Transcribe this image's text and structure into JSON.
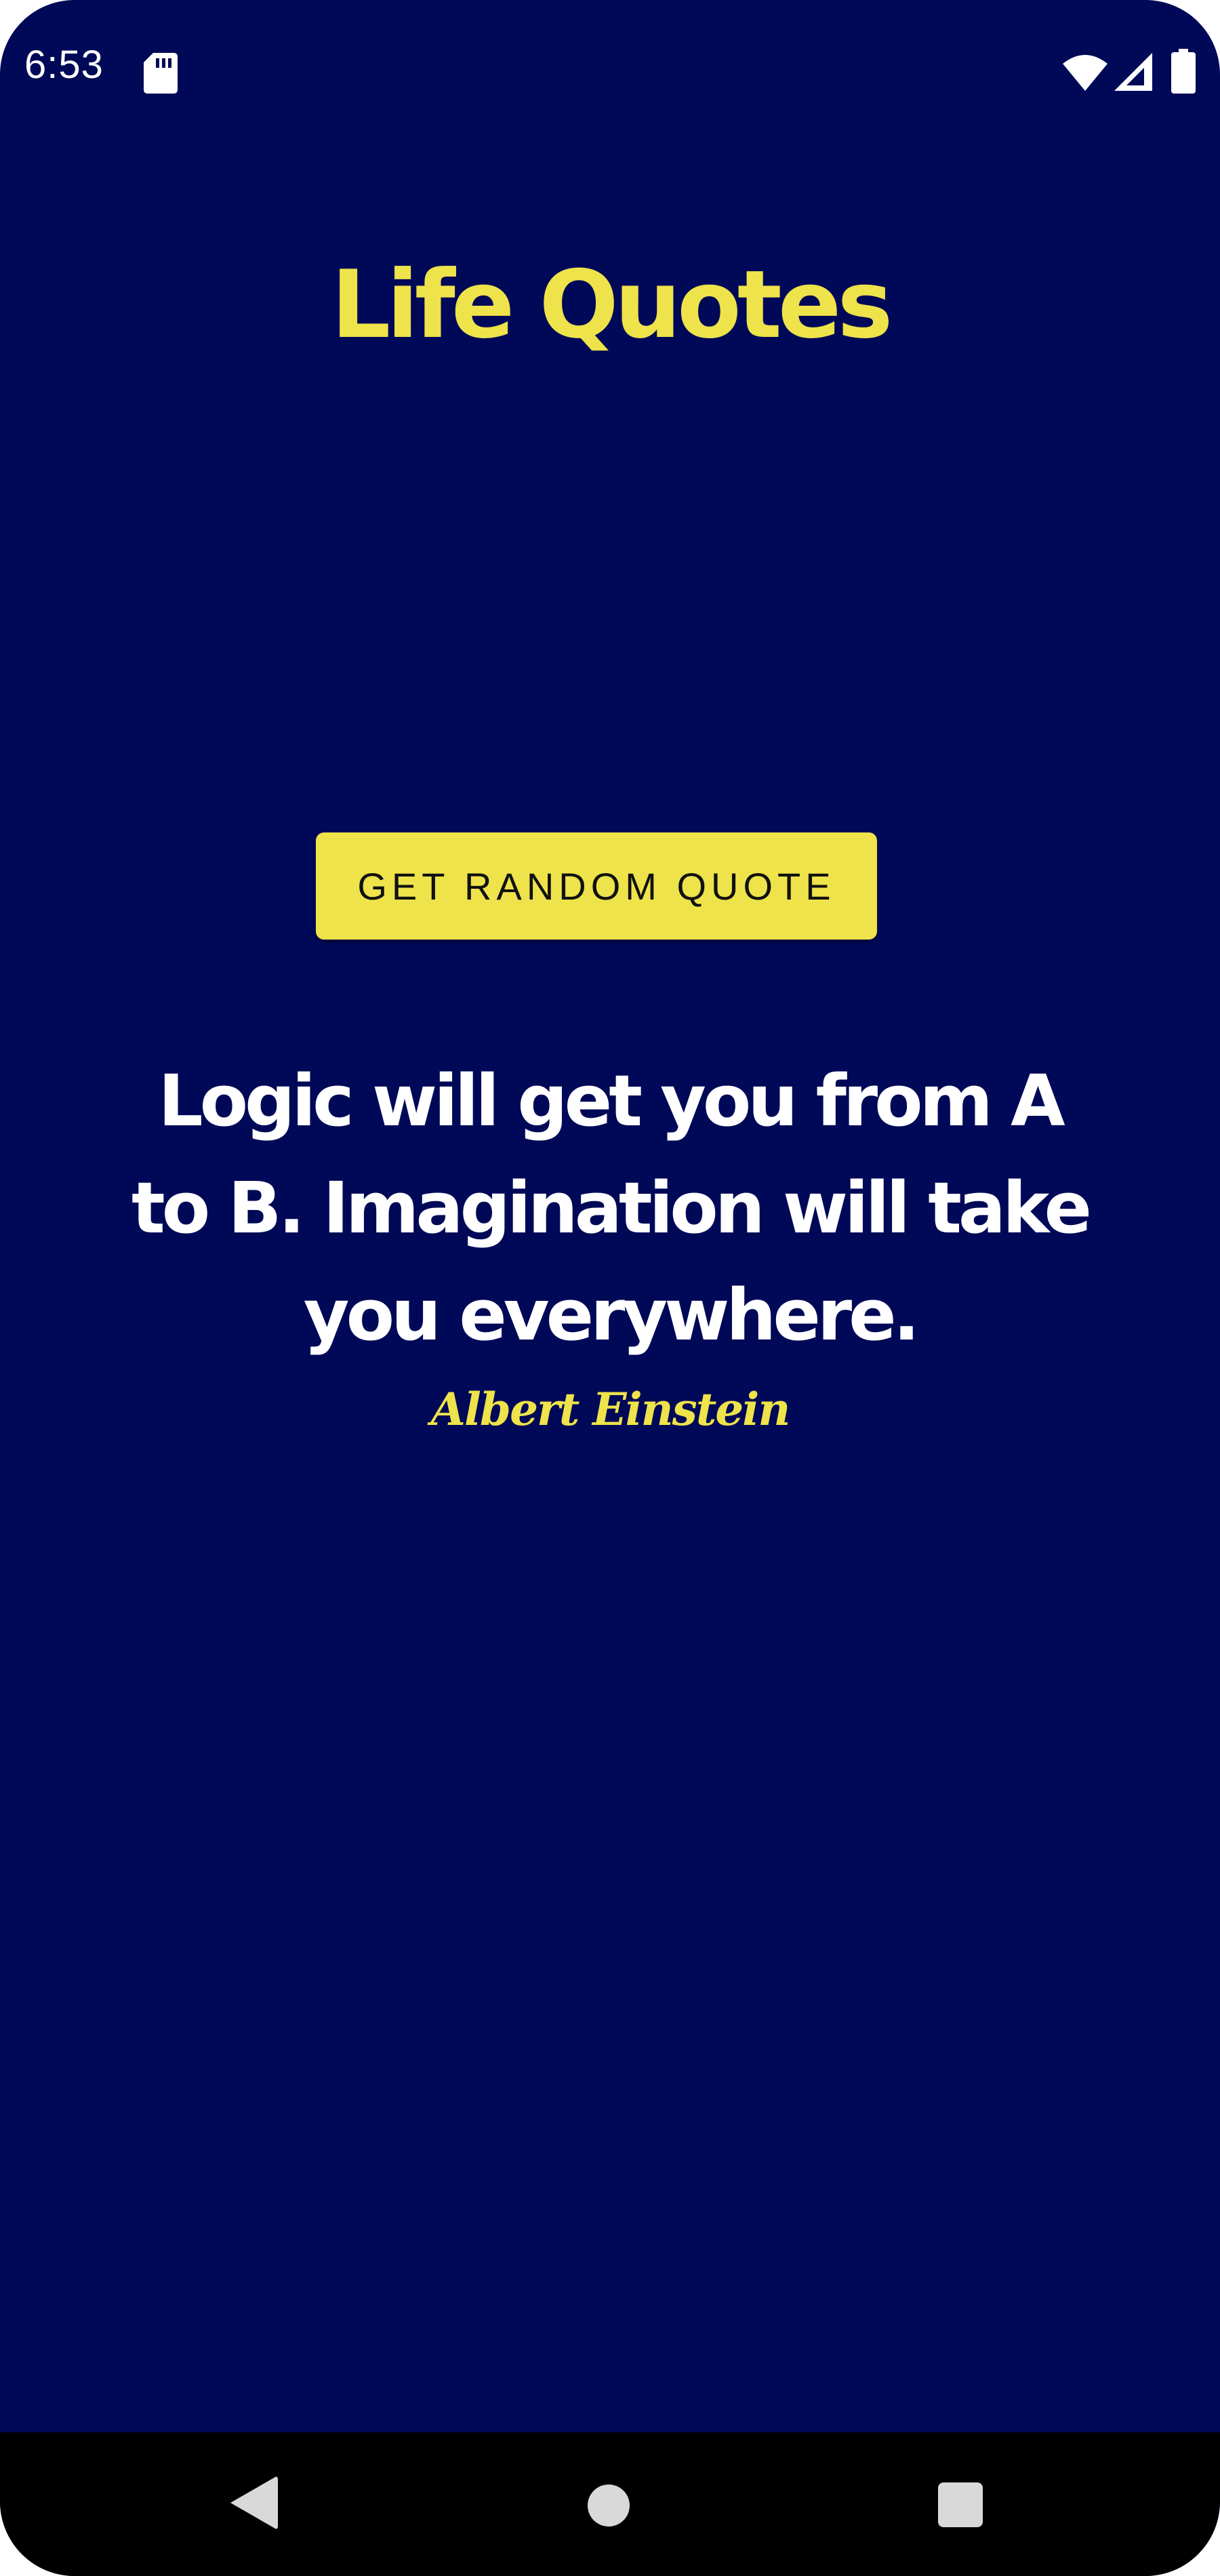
{
  "status_bar": {
    "time": "6:53",
    "icons": [
      "sd-card-icon",
      "wifi-icon",
      "signal-icon",
      "battery-icon"
    ]
  },
  "app": {
    "title": "Life Quotes",
    "button_label": "GET RANDOM QUOTE",
    "quote": "Logic will get you from A to B. Imagination will take you everywhere.",
    "author": "Albert Einstein"
  },
  "nav_bar": {
    "icons": [
      "back-icon",
      "home-icon",
      "recents-icon"
    ]
  },
  "colors": {
    "background": "#000957",
    "accent": "#EEE34A",
    "quote_text": "#FFFFFF",
    "nav_bar": "#000000"
  }
}
